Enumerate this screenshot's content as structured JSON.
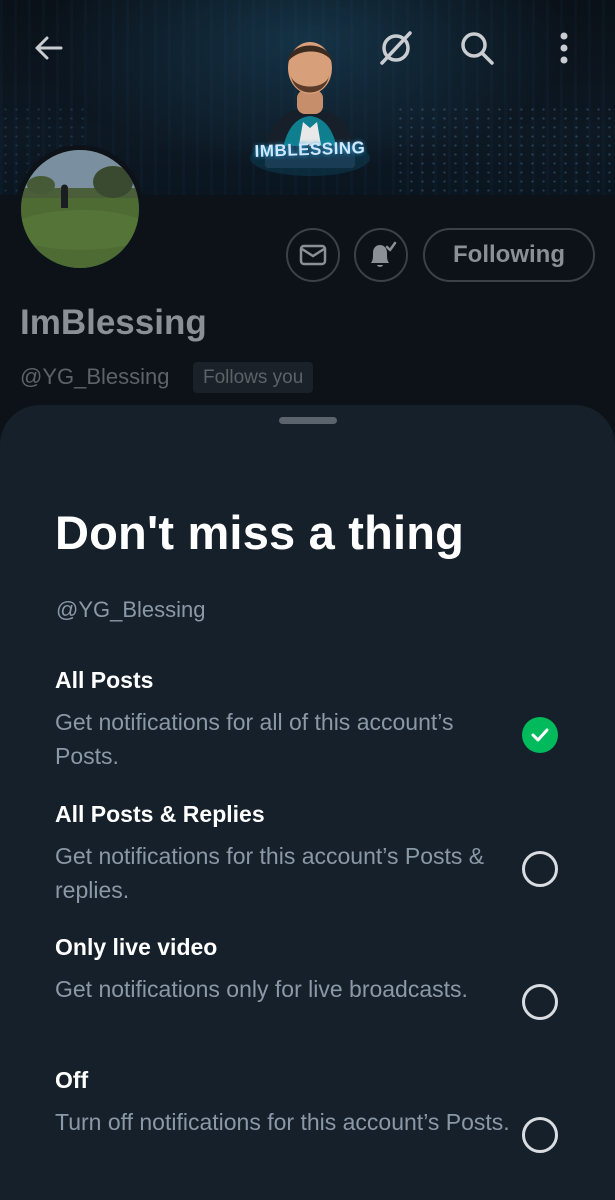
{
  "app": {
    "name": "X"
  },
  "colors": {
    "sheet_background": "#16202a",
    "page_background": "#0c1117",
    "accent_check": "#00ba5c",
    "text_primary": "#ffffff",
    "text_secondary": "#8b98a5"
  },
  "header": {
    "back_icon": "arrow-left-icon",
    "grok_icon": "slashed-circle-icon",
    "search_icon": "search-icon",
    "more_icon": "vertical-dots-icon",
    "banner_logo_text": "IMBLESSING"
  },
  "profile": {
    "display_name": "ImBlessing",
    "handle": "@YG_Blessing",
    "follows_you_badge": "Follows you",
    "following_button": "Following",
    "message_icon": "envelope-icon",
    "notification_icon": "bell-check-icon"
  },
  "sheet": {
    "title": "Don't miss a thing",
    "handle": "@YG_Blessing",
    "options": [
      {
        "title": "All Posts",
        "description": "Get notifications for all of this account’s Posts.",
        "selected": true
      },
      {
        "title": "All Posts & Replies",
        "description": "Get notifications for this account’s Posts & replies.",
        "selected": false
      },
      {
        "title": "Only live video",
        "description": "Get notifications only for live broadcasts.",
        "selected": false
      },
      {
        "title": "Off",
        "description": "Turn off notifications for this account’s Posts.",
        "selected": false
      }
    ]
  }
}
